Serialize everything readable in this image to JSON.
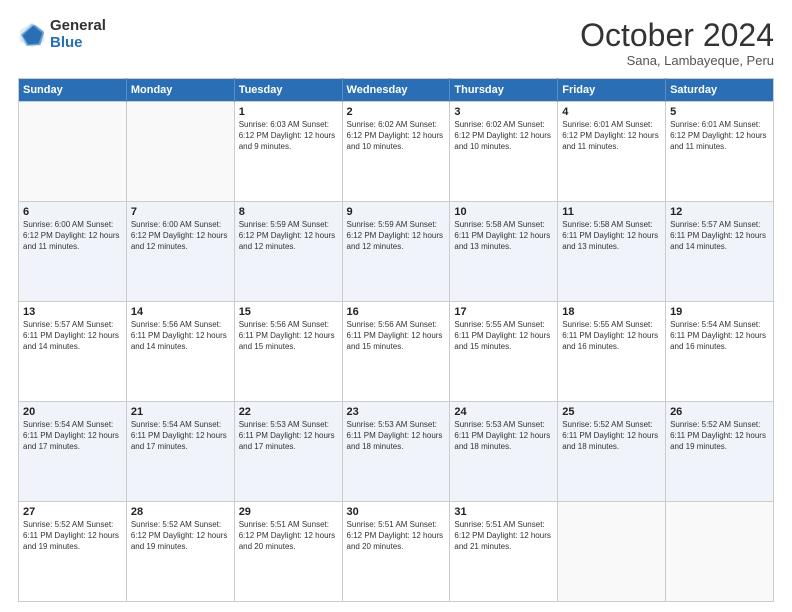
{
  "header": {
    "logo_general": "General",
    "logo_blue": "Blue",
    "month_title": "October 2024",
    "subtitle": "Sana, Lambayeque, Peru"
  },
  "weekdays": [
    "Sunday",
    "Monday",
    "Tuesday",
    "Wednesday",
    "Thursday",
    "Friday",
    "Saturday"
  ],
  "rows": [
    [
      {
        "day": "",
        "info": ""
      },
      {
        "day": "",
        "info": ""
      },
      {
        "day": "1",
        "info": "Sunrise: 6:03 AM\nSunset: 6:12 PM\nDaylight: 12 hours and 9 minutes."
      },
      {
        "day": "2",
        "info": "Sunrise: 6:02 AM\nSunset: 6:12 PM\nDaylight: 12 hours and 10 minutes."
      },
      {
        "day": "3",
        "info": "Sunrise: 6:02 AM\nSunset: 6:12 PM\nDaylight: 12 hours and 10 minutes."
      },
      {
        "day": "4",
        "info": "Sunrise: 6:01 AM\nSunset: 6:12 PM\nDaylight: 12 hours and 11 minutes."
      },
      {
        "day": "5",
        "info": "Sunrise: 6:01 AM\nSunset: 6:12 PM\nDaylight: 12 hours and 11 minutes."
      }
    ],
    [
      {
        "day": "6",
        "info": "Sunrise: 6:00 AM\nSunset: 6:12 PM\nDaylight: 12 hours and 11 minutes."
      },
      {
        "day": "7",
        "info": "Sunrise: 6:00 AM\nSunset: 6:12 PM\nDaylight: 12 hours and 12 minutes."
      },
      {
        "day": "8",
        "info": "Sunrise: 5:59 AM\nSunset: 6:12 PM\nDaylight: 12 hours and 12 minutes."
      },
      {
        "day": "9",
        "info": "Sunrise: 5:59 AM\nSunset: 6:12 PM\nDaylight: 12 hours and 12 minutes."
      },
      {
        "day": "10",
        "info": "Sunrise: 5:58 AM\nSunset: 6:11 PM\nDaylight: 12 hours and 13 minutes."
      },
      {
        "day": "11",
        "info": "Sunrise: 5:58 AM\nSunset: 6:11 PM\nDaylight: 12 hours and 13 minutes."
      },
      {
        "day": "12",
        "info": "Sunrise: 5:57 AM\nSunset: 6:11 PM\nDaylight: 12 hours and 14 minutes."
      }
    ],
    [
      {
        "day": "13",
        "info": "Sunrise: 5:57 AM\nSunset: 6:11 PM\nDaylight: 12 hours and 14 minutes."
      },
      {
        "day": "14",
        "info": "Sunrise: 5:56 AM\nSunset: 6:11 PM\nDaylight: 12 hours and 14 minutes."
      },
      {
        "day": "15",
        "info": "Sunrise: 5:56 AM\nSunset: 6:11 PM\nDaylight: 12 hours and 15 minutes."
      },
      {
        "day": "16",
        "info": "Sunrise: 5:56 AM\nSunset: 6:11 PM\nDaylight: 12 hours and 15 minutes."
      },
      {
        "day": "17",
        "info": "Sunrise: 5:55 AM\nSunset: 6:11 PM\nDaylight: 12 hours and 15 minutes."
      },
      {
        "day": "18",
        "info": "Sunrise: 5:55 AM\nSunset: 6:11 PM\nDaylight: 12 hours and 16 minutes."
      },
      {
        "day": "19",
        "info": "Sunrise: 5:54 AM\nSunset: 6:11 PM\nDaylight: 12 hours and 16 minutes."
      }
    ],
    [
      {
        "day": "20",
        "info": "Sunrise: 5:54 AM\nSunset: 6:11 PM\nDaylight: 12 hours and 17 minutes."
      },
      {
        "day": "21",
        "info": "Sunrise: 5:54 AM\nSunset: 6:11 PM\nDaylight: 12 hours and 17 minutes."
      },
      {
        "day": "22",
        "info": "Sunrise: 5:53 AM\nSunset: 6:11 PM\nDaylight: 12 hours and 17 minutes."
      },
      {
        "day": "23",
        "info": "Sunrise: 5:53 AM\nSunset: 6:11 PM\nDaylight: 12 hours and 18 minutes."
      },
      {
        "day": "24",
        "info": "Sunrise: 5:53 AM\nSunset: 6:11 PM\nDaylight: 12 hours and 18 minutes."
      },
      {
        "day": "25",
        "info": "Sunrise: 5:52 AM\nSunset: 6:11 PM\nDaylight: 12 hours and 18 minutes."
      },
      {
        "day": "26",
        "info": "Sunrise: 5:52 AM\nSunset: 6:11 PM\nDaylight: 12 hours and 19 minutes."
      }
    ],
    [
      {
        "day": "27",
        "info": "Sunrise: 5:52 AM\nSunset: 6:11 PM\nDaylight: 12 hours and 19 minutes."
      },
      {
        "day": "28",
        "info": "Sunrise: 5:52 AM\nSunset: 6:12 PM\nDaylight: 12 hours and 19 minutes."
      },
      {
        "day": "29",
        "info": "Sunrise: 5:51 AM\nSunset: 6:12 PM\nDaylight: 12 hours and 20 minutes."
      },
      {
        "day": "30",
        "info": "Sunrise: 5:51 AM\nSunset: 6:12 PM\nDaylight: 12 hours and 20 minutes."
      },
      {
        "day": "31",
        "info": "Sunrise: 5:51 AM\nSunset: 6:12 PM\nDaylight: 12 hours and 21 minutes."
      },
      {
        "day": "",
        "info": ""
      },
      {
        "day": "",
        "info": ""
      }
    ]
  ]
}
